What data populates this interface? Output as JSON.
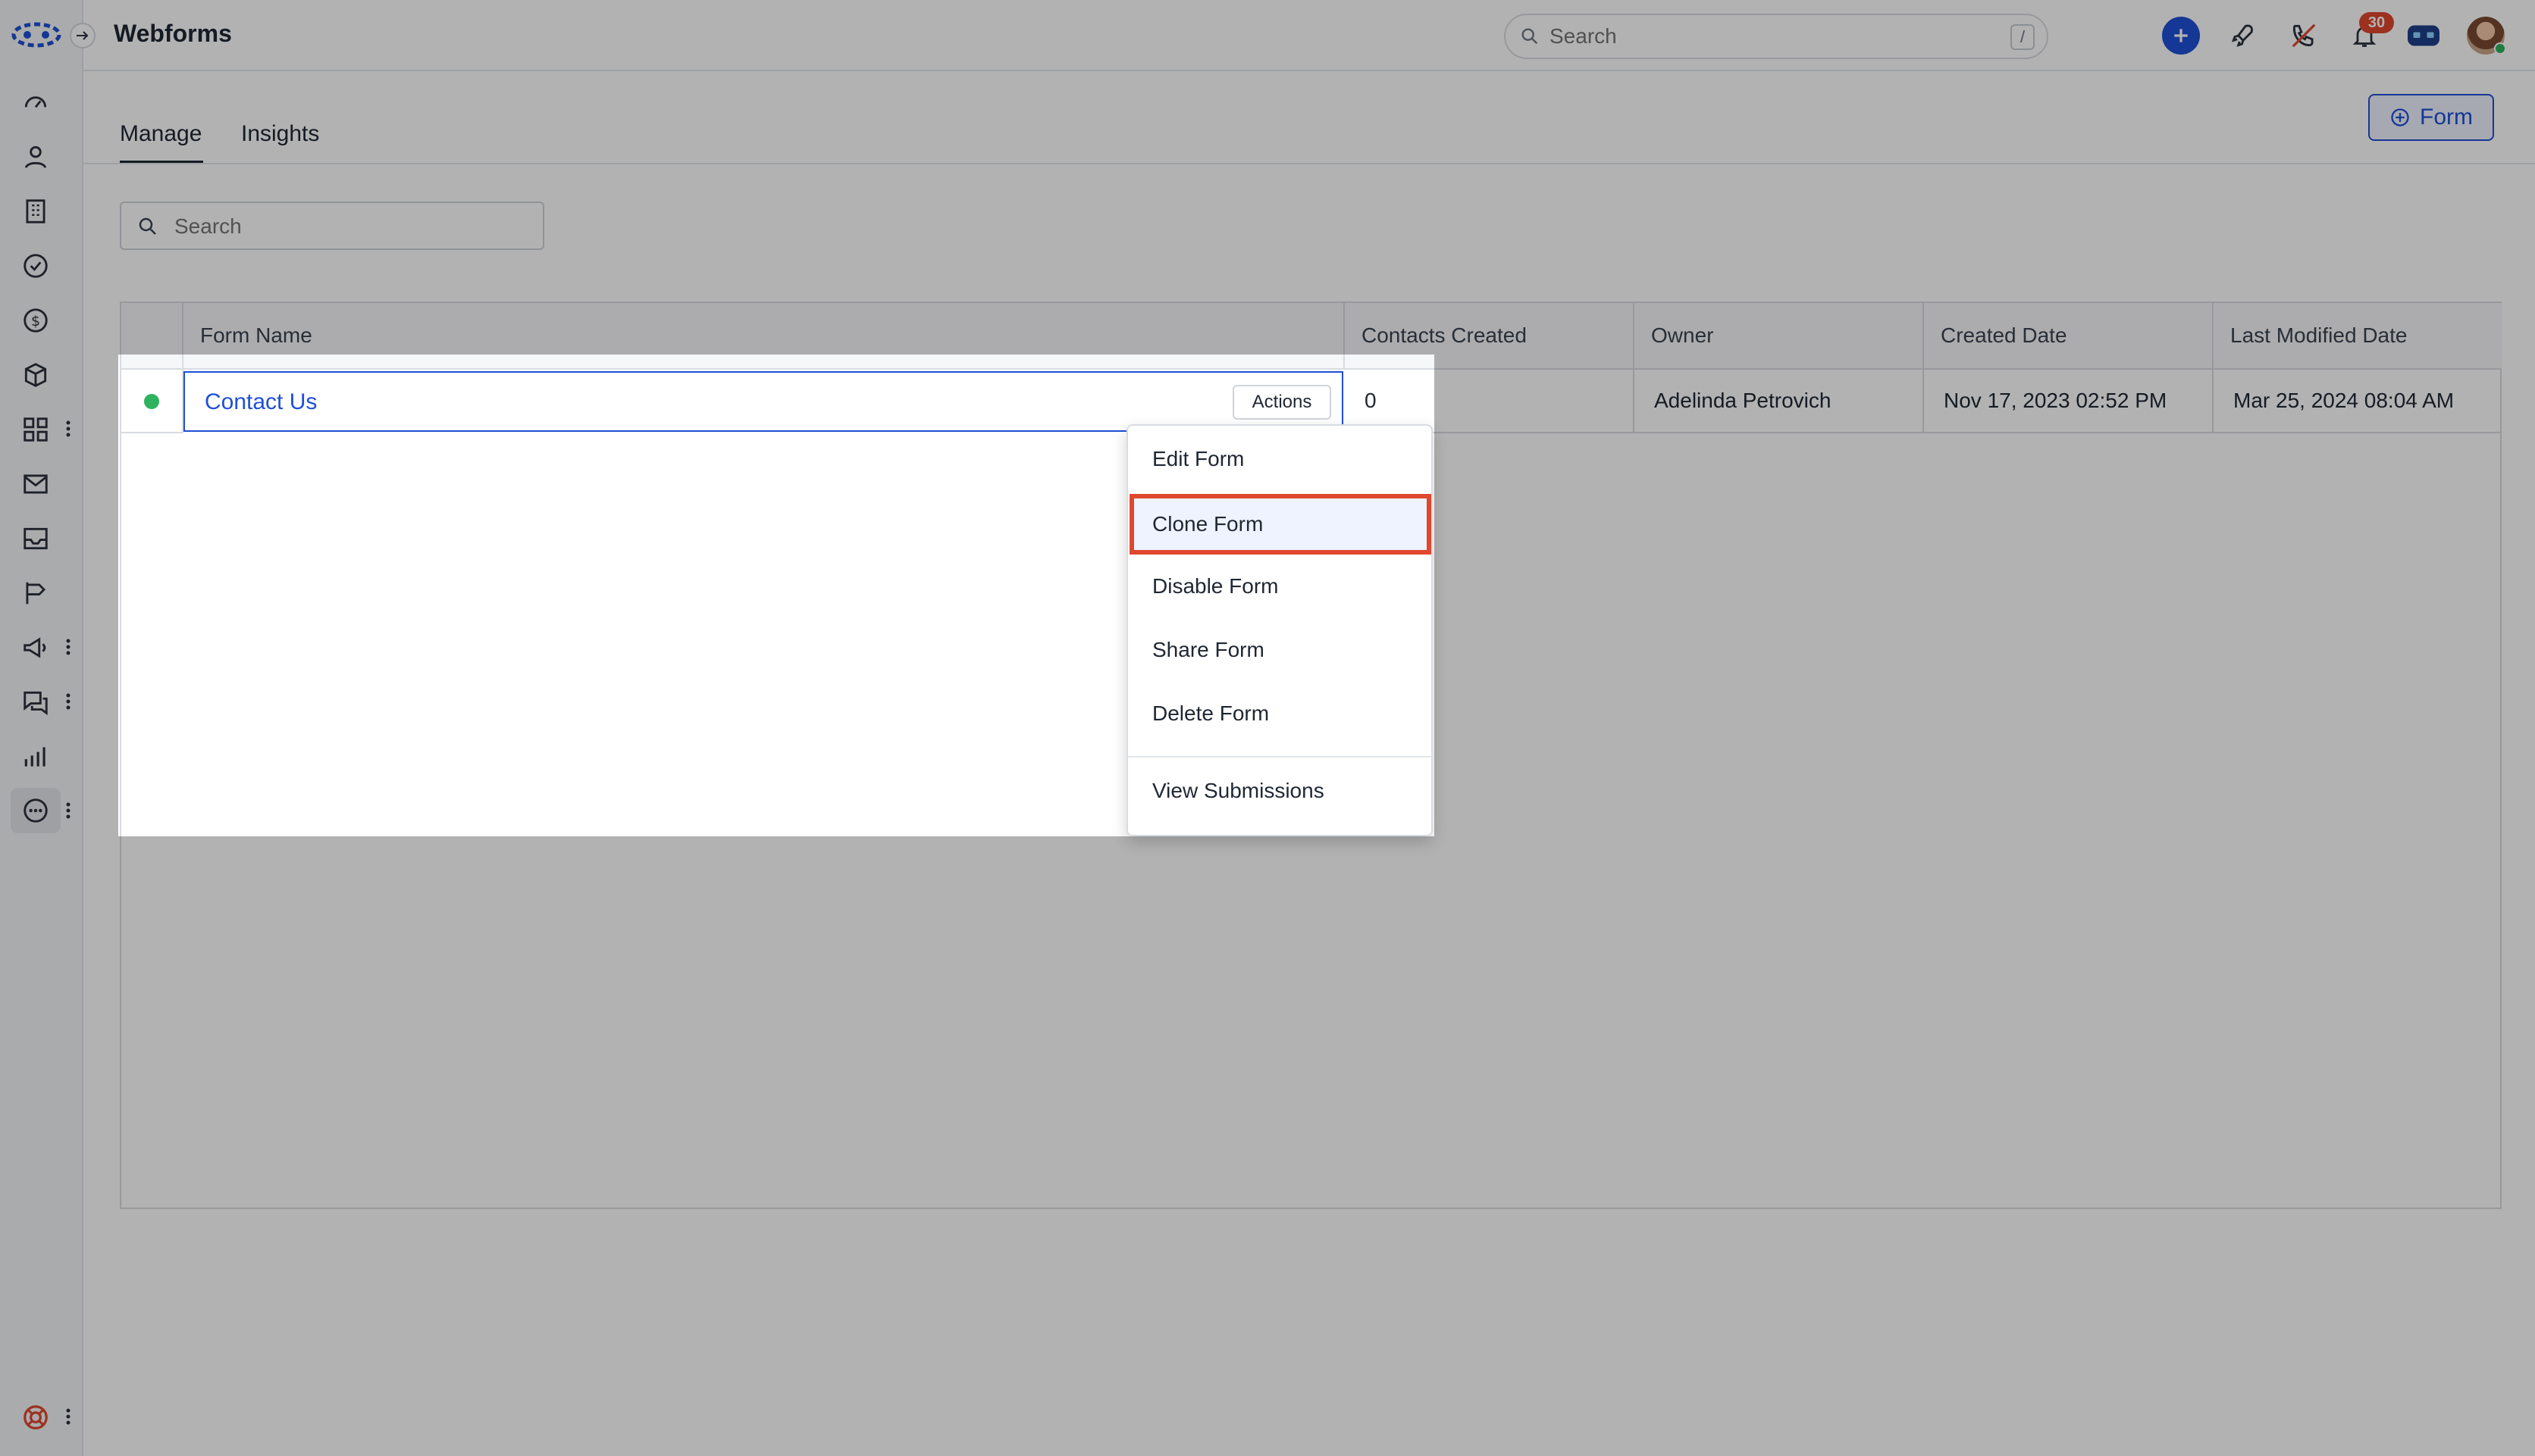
{
  "header": {
    "title": "Webforms",
    "search_placeholder": "Search",
    "search_shortcut": "/",
    "notification_count": "30"
  },
  "tabs": [
    {
      "label": "Manage",
      "active": true
    },
    {
      "label": "Insights",
      "active": false
    }
  ],
  "create_button": {
    "label": "Form",
    "icon": "plus-circle-icon"
  },
  "table_search": {
    "placeholder": "Search"
  },
  "table": {
    "columns": [
      "Form Name",
      "Contacts Created",
      "Owner",
      "Created Date",
      "Last Modified Date"
    ],
    "rows": [
      {
        "status": "active",
        "form_name": "Contact Us",
        "contacts_created": "0",
        "owner": "Adelinda Petrovich",
        "created_date": "Nov 17, 2023 02:52 PM",
        "last_modified_date": "Mar 25, 2024 08:04 AM",
        "actions_label": "Actions"
      }
    ]
  },
  "actions_menu": {
    "items": [
      {
        "label": "Edit Form"
      },
      {
        "label": "Clone Form",
        "highlighted": true
      },
      {
        "label": "Disable Form"
      },
      {
        "label": "Share Form"
      },
      {
        "label": "Delete Form"
      },
      {
        "label": "View Submissions"
      }
    ]
  },
  "sidebar": {
    "icons": [
      "dashboard-icon",
      "contacts-icon",
      "companies-icon",
      "tasks-icon",
      "deals-icon",
      "products-icon",
      "apps-icon",
      "email-icon",
      "inbox-icon",
      "sequences-icon",
      "campaigns-icon",
      "chat-icon",
      "reports-icon",
      "more-icon",
      "help-icon"
    ]
  },
  "colors": {
    "accent": "#1f4fd6",
    "status_active": "#2fb25d",
    "highlight_border": "#e0472f",
    "badge": "#e0472f"
  }
}
